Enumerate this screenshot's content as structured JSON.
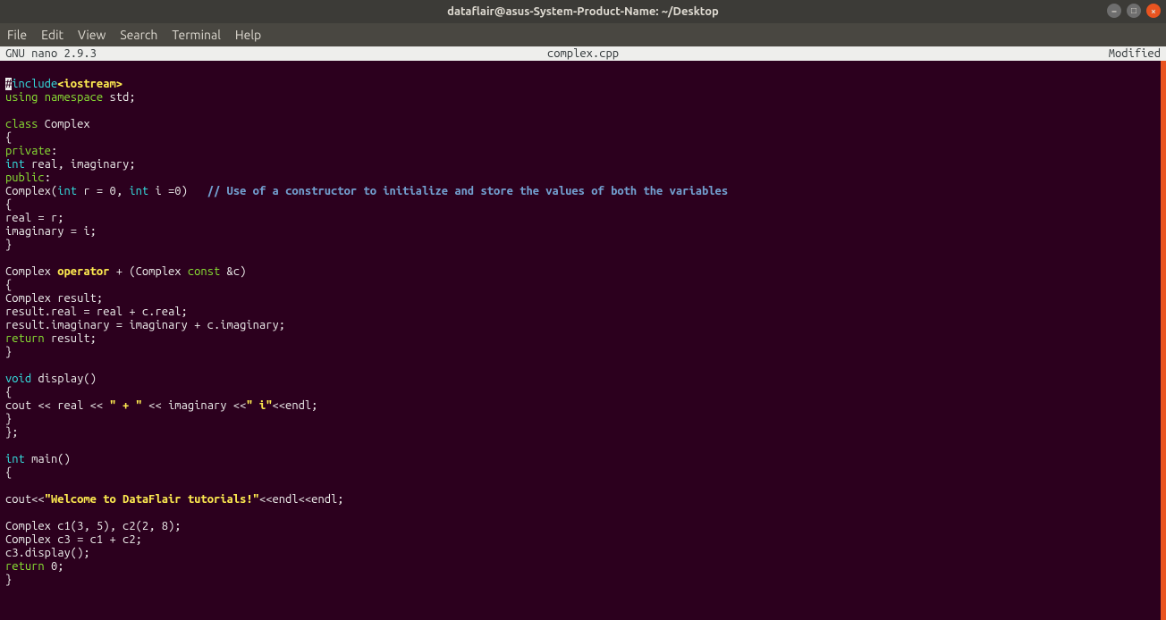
{
  "titlebar": {
    "title": "dataflair@asus-System-Product-Name: ~/Desktop"
  },
  "menubar": {
    "items": [
      "File",
      "Edit",
      "View",
      "Search",
      "Terminal",
      "Help"
    ]
  },
  "nanobar": {
    "version": "  GNU nano 2.9.3",
    "filename": "complex.cpp",
    "status": "Modified"
  },
  "code": {
    "include_hash": "#",
    "include_rest": "include",
    "include_hdr": "<iostream>",
    "using": "using",
    "namespace": "namespace",
    "std": " std;",
    "class_kw": "class",
    "class_name": " Complex",
    "ob": "{",
    "private_kw": "private",
    "colon": ":",
    "int_kw": "int",
    "realimag": " real, imaginary;",
    "public_kw": "public",
    "complex_ctor_1": "Complex(",
    "int1": "int",
    "ctor_r": " r = 0, ",
    "int2": "int",
    "ctor_i": " i =0)   ",
    "ctor_cmt": "// Use of a constructor to initialize and store the values of both the variables",
    "real_r": "real = r;",
    "imag_i": "imaginary = i;",
    "cb": "}",
    "complex_op_pre": "Complex ",
    "operator_kw": "operator",
    "complex_op_mid": " + (Complex ",
    "const_kw": "const",
    "complex_op_post": " &c)",
    "result_decl": "Complex result;",
    "result_real": "result.real = real + c.real;",
    "result_imag": "result.imaginary = imaginary + c.imaginary;",
    "return_kw": "return",
    "return_result": " result;",
    "void_kw": "void",
    "display": " display()",
    "cout_line_a": "cout << real << ",
    "plus_str": "\" + \"",
    "cout_line_b": " << imaginary <<",
    "i_str": "\" i\"",
    "cout_line_c": "<<endl;",
    "endclass": "};",
    "main_kw": "int",
    "main_decl": " main()",
    "cout2a": "cout<<",
    "welcome_str": "\"Welcome to DataFlair tutorials!\"",
    "cout2b": "<<endl<<endl;",
    "c1c2": "Complex c1(3, 5), c2(2, 8);",
    "c3": "Complex c3 = c1 + c2;",
    "c3disp": "c3.display();",
    "return0_kw": "return",
    "return0": " 0;"
  }
}
